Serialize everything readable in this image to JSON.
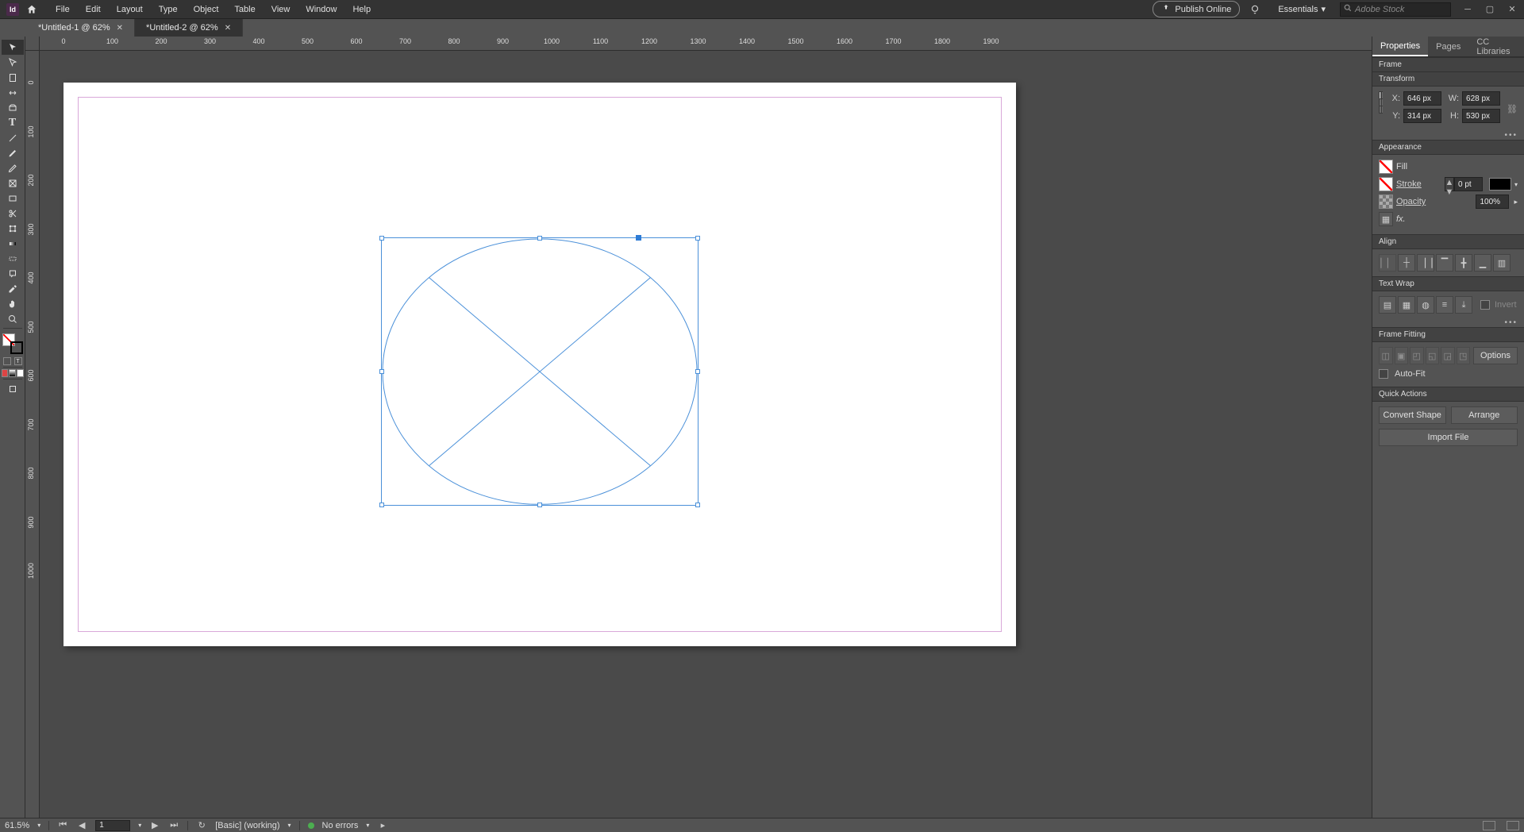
{
  "menu": {
    "items": [
      "File",
      "Edit",
      "Layout",
      "Type",
      "Object",
      "Table",
      "View",
      "Window",
      "Help"
    ]
  },
  "top": {
    "publish": "Publish Online",
    "workspace": "Essentials",
    "search_placeholder": "Adobe Stock"
  },
  "tabs": [
    {
      "label": "*Untitled-1 @ 62%",
      "active": false
    },
    {
      "label": "*Untitled-2 @ 62%",
      "active": true
    }
  ],
  "ruler_h": [
    0,
    100,
    200,
    300,
    400,
    500,
    600,
    700,
    800,
    900,
    1000,
    1100,
    1200,
    1300,
    1400,
    1500,
    1600,
    1700,
    1800,
    1900
  ],
  "ruler_v": [
    0,
    100,
    200,
    300,
    400,
    500,
    600,
    700,
    800,
    900,
    1000
  ],
  "panel": {
    "tabs": [
      "Properties",
      "Pages",
      "CC Libraries"
    ],
    "selection_type": "Frame",
    "sections": {
      "transform": "Transform",
      "appearance": "Appearance",
      "align": "Align",
      "textwrap": "Text Wrap",
      "framefit": "Frame Fitting",
      "quick": "Quick Actions"
    },
    "transform": {
      "x": "646 px",
      "y": "314 px",
      "w": "628 px",
      "h": "530 px",
      "x_lbl": "X:",
      "y_lbl": "Y:",
      "w_lbl": "W:",
      "h_lbl": "H:"
    },
    "appearance": {
      "fill_lbl": "Fill",
      "stroke_lbl": "Stroke",
      "stroke_val": "0 pt",
      "opacity_lbl": "Opacity",
      "opacity_val": "100%",
      "fx_lbl": "fx."
    },
    "textwrap": {
      "invert": "Invert"
    },
    "framefit": {
      "options": "Options",
      "autofit": "Auto-Fit"
    },
    "quick": {
      "convert": "Convert Shape",
      "arrange": "Arrange",
      "import": "Import File"
    }
  },
  "status": {
    "zoom": "61.5%",
    "page": "1",
    "style": "[Basic] (working)",
    "errors": "No errors"
  }
}
